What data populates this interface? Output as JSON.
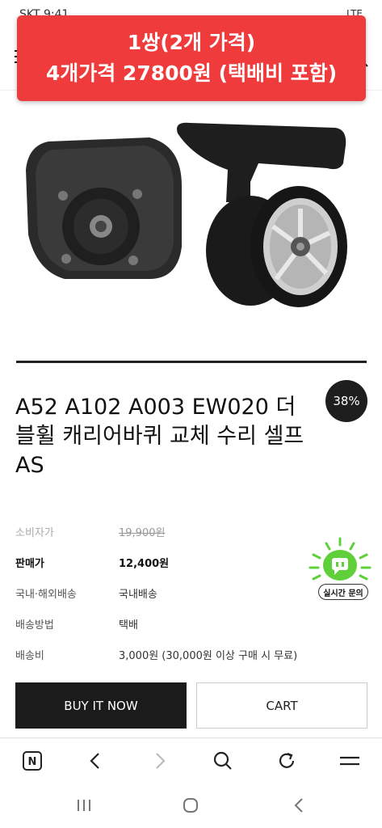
{
  "status_bar": {
    "time": "SKT 9:41",
    "right": "LTE"
  },
  "promo": {
    "line1": "1쌍(2개 가격)",
    "line2": "4개가격 27800원 (택배비 포함)"
  },
  "product": {
    "discount_badge": "38%",
    "title": "A52 A102 A003 EW020 더블휠 캐리어바퀴 교체 수리 셀프 AS"
  },
  "info": {
    "consumer_price_label": "소비자가",
    "consumer_price_value": "19,900원",
    "sale_price_label": "판매가",
    "sale_price_value": "12,400원",
    "shipping_region_label": "국내·해외배송",
    "shipping_region_value": "국내배송",
    "shipping_method_label": "배송방법",
    "shipping_method_value": "택배",
    "shipping_fee_label": "배송비",
    "shipping_fee_value": "3,000원 (30,000원 이상 구매 시 무료)"
  },
  "chat_widget": {
    "label": "실시간 문의",
    "icon": "chat-icon"
  },
  "buttons": {
    "buy_now": "BUY IT NOW",
    "cart": "CART"
  },
  "browser_bar": {
    "icons": [
      "naver-home-icon",
      "back-icon",
      "forward-icon",
      "search-icon",
      "refresh-icon",
      "menu-icon"
    ],
    "home_glyph": "N"
  },
  "system_nav": {
    "icons": [
      "recents-icon",
      "home-icon",
      "back-icon"
    ]
  },
  "colors": {
    "banner": "#ef3b3b",
    "dark": "#1b1b1b",
    "chat_green": "#5fcf3a"
  }
}
